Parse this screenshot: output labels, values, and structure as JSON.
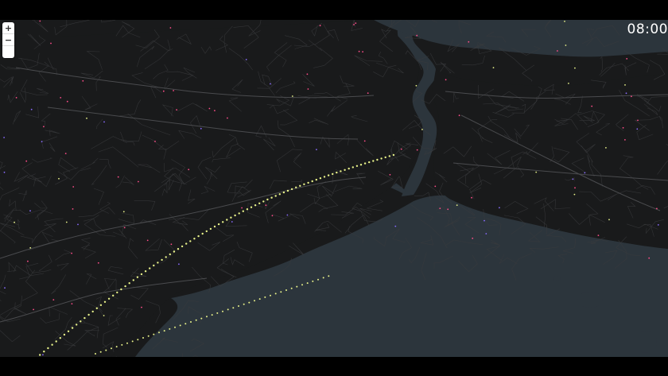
{
  "map": {
    "colors": {
      "land": "#191a1b",
      "water": "#2c353c",
      "road": "#3a3b3d",
      "road_major": "#4a4b4e",
      "traffic_yellow": "#e8f28a",
      "traffic_pink": "#ff4d8a",
      "traffic_purple": "#8a6cff"
    }
  },
  "controls": {
    "zoom_in_label": "+",
    "zoom_out_label": "−",
    "compass_icon": "north-arrow-icon"
  },
  "time": {
    "icon": "clock-restart-icon",
    "value": "08:00"
  }
}
